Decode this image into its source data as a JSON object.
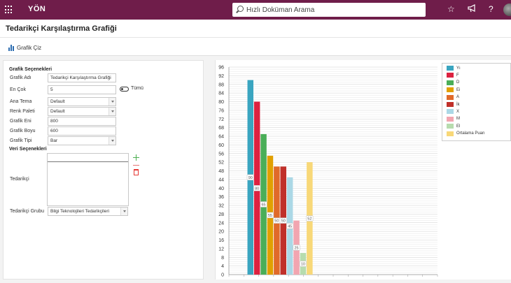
{
  "topbar": {
    "logo": "YÖN",
    "search_placeholder": "Hızlı Doküman Arama",
    "icons": [
      "apps-grid-icon",
      "star-icon",
      "megaphone-icon",
      "help-icon"
    ],
    "help_label": "?"
  },
  "page": {
    "title": "Tedarikçi Karşılaştırma Grafiği"
  },
  "toolbar": {
    "draw_chart_label": "Grafik Çiz"
  },
  "form": {
    "chart_section": "Grafik Seçenekleri",
    "chart_name_label": "Grafik Adı",
    "chart_name_value": "Tedarikçi Karşılaştırma Grafiği",
    "max_label": "En Çok",
    "max_value": "5",
    "all_label": "Tümü",
    "theme_label": "Ana Tema",
    "theme_value": "Default",
    "palette_label": "Renk Paleti",
    "palette_value": "Default",
    "width_label": "Grafik Eni",
    "width_value": "800",
    "height_label": "Grafik Boyu",
    "height_value": "600",
    "type_label": "Grafik Tipi",
    "type_value": "Bar",
    "data_section": "Veri Seçenekleri",
    "supplier_label": "Tedarikçi",
    "group_label": "Tedarikçi Grubu",
    "group_value": "Bilgi Teknolojileri Tedarikçileri"
  },
  "chart_data": {
    "type": "bar",
    "ylim": [
      0,
      96
    ],
    "yticks": [
      "96",
      "92",
      "88",
      "84",
      "80",
      "76",
      "72",
      "68",
      "64",
      "60",
      "56",
      "52",
      "48",
      "44",
      "40",
      "36",
      "32",
      "28",
      "24",
      "20",
      "16",
      "12",
      "8",
      "4",
      "0"
    ],
    "series": [
      {
        "name": "Yı",
        "value": 90,
        "label": "90",
        "color": "#3aa5c0"
      },
      {
        "name": "F",
        "value": 80,
        "label": "80",
        "color": "#dc2240"
      },
      {
        "name": "D",
        "value": 65,
        "label": "65",
        "color": "#4aae58"
      },
      {
        "name": "Ei",
        "value": 55,
        "label": "55",
        "color": "#e1a000"
      },
      {
        "name": "A",
        "value": 50,
        "label": "50",
        "color": "#e06a2a"
      },
      {
        "name": "İk",
        "value": 50,
        "label": "50",
        "color": "#c0302a"
      },
      {
        "name": "X",
        "value": 45,
        "label": "45",
        "color": "#abd8e6"
      },
      {
        "name": "M",
        "value": 25,
        "label": "25",
        "color": "#f2a5b0"
      },
      {
        "name": "El",
        "value": 10,
        "label": "10",
        "color": "#b7dcae"
      },
      {
        "name": "Ortalama Puan",
        "value": 52,
        "label": "52",
        "color": "#f8d878"
      }
    ]
  }
}
